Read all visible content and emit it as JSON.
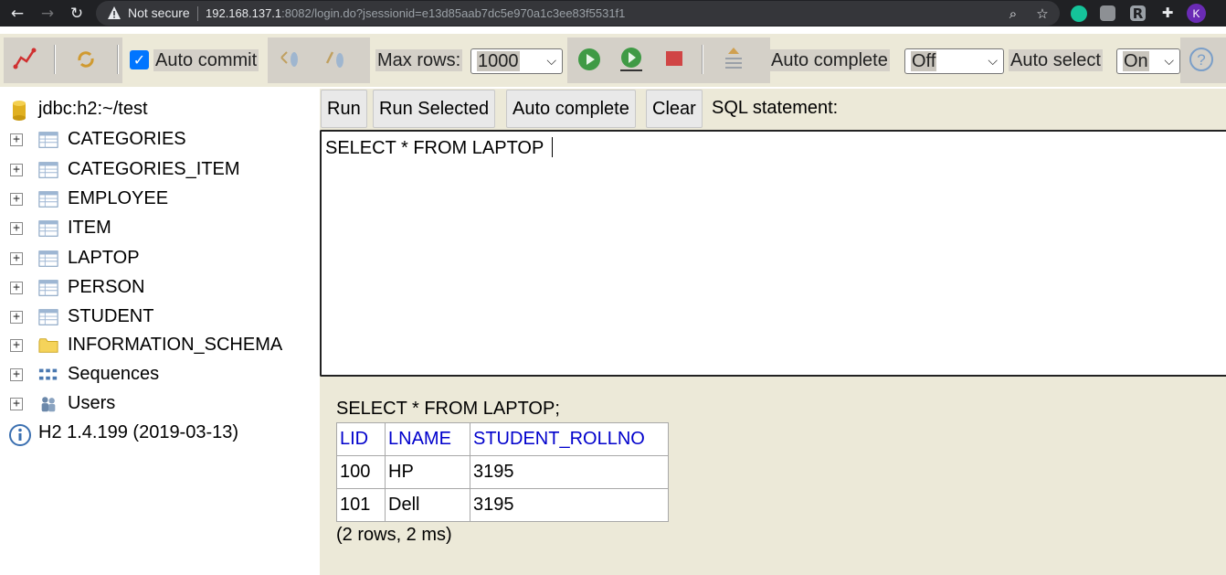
{
  "browser": {
    "not_secure": "Not secure",
    "url_host": "192.168.137.1",
    "url_rest": ":8082/login.do?jsessionid=e13d85aab7dc5e970a1c3ee83f5531f1",
    "profile_initial": "K",
    "ext_r": "R"
  },
  "toolbar": {
    "auto_commit_label": "Auto commit",
    "auto_commit_checked": true,
    "max_rows_label": "Max rows:",
    "max_rows_value": "1000",
    "auto_complete_label": "Auto complete",
    "auto_complete_value": "Off",
    "auto_select_label": "Auto select",
    "auto_select_value": "On",
    "help_glyph": "?"
  },
  "tree": {
    "connection": "jdbc:h2:~/test",
    "tables": [
      "CATEGORIES",
      "CATEGORIES_ITEM",
      "EMPLOYEE",
      "ITEM",
      "LAPTOP",
      "PERSON",
      "STUDENT"
    ],
    "schema": "INFORMATION_SCHEMA",
    "sequences": "Sequences",
    "users": "Users",
    "version": "H2 1.4.199 (2019-03-13)"
  },
  "editor": {
    "buttons": [
      "Run",
      "Run Selected",
      "Auto complete",
      "Clear"
    ],
    "sql_label": "SQL statement:",
    "sql_text": "SELECT * FROM LAPTOP "
  },
  "result": {
    "statement": "SELECT * FROM LAPTOP;",
    "columns": [
      "LID",
      "LNAME",
      "STUDENT_ROLLNO"
    ],
    "rows": [
      [
        "100",
        "HP",
        "3195"
      ],
      [
        "101",
        "Dell",
        "3195"
      ]
    ],
    "info": "(2 rows, 2 ms)"
  },
  "colors": {
    "toolbar_bg": "#ece9d8",
    "column_header": "#0000cc",
    "checkbox": "#0075ff"
  }
}
